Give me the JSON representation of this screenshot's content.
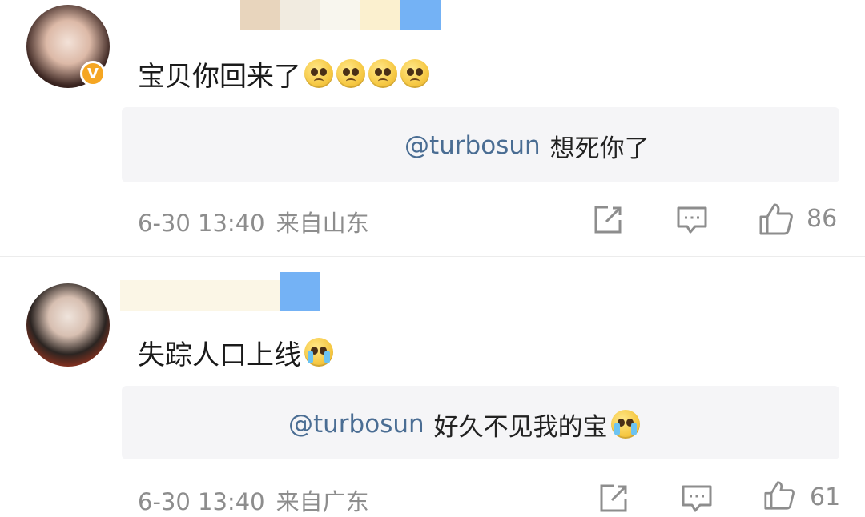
{
  "comments": [
    {
      "text": "宝贝你回来了",
      "emoji_icons": [
        "pleading-face-icon",
        "pleading-face-icon",
        "pleading-face-icon",
        "pleading-face-icon"
      ],
      "reply": {
        "mention": "@turbosun",
        "text": "想死你了"
      },
      "date": "6-30 13:40",
      "location": "来自山东",
      "likes": "86",
      "verified": true
    },
    {
      "text": "失踪人口上线",
      "emoji_icons": [
        "crying-face-icon"
      ],
      "reply": {
        "mention": "@turbosun",
        "text": "好久不见我的宝",
        "emoji_icon": "crying-face-icon"
      },
      "date": "6-30 13:40",
      "location": "来自广东",
      "likes": "61",
      "verified": false
    }
  ],
  "icons": {
    "share": "share-icon",
    "comment": "comment-icon",
    "like": "thumbs-up-icon"
  },
  "colors": {
    "mention": "#4a6d93",
    "meta": "#8d8d8d",
    "reply_bg": "#f5f5f7",
    "verified_badge": "#f5a623"
  }
}
